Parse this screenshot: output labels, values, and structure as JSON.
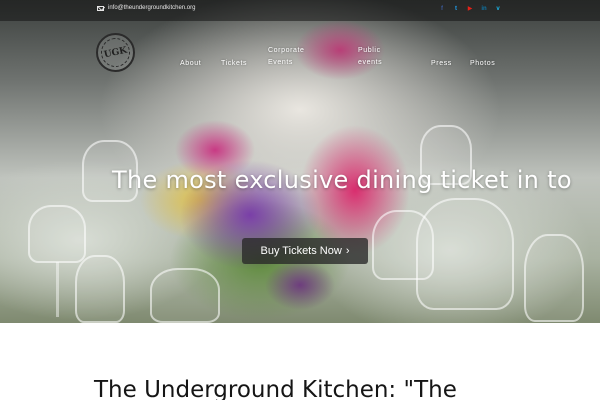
{
  "topbar": {
    "email": "info@theundergroundkitchen.org",
    "social_icons": [
      {
        "icon": "facebook-icon",
        "glyph": "f",
        "color": "#3b5998"
      },
      {
        "icon": "twitter-icon",
        "glyph": "t",
        "color": "#1da1f2"
      },
      {
        "icon": "youtube-icon",
        "glyph": "▶",
        "color": "#e62117"
      },
      {
        "icon": "linkedin-icon",
        "glyph": "in",
        "color": "#0e76a8"
      },
      {
        "icon": "vimeo-icon",
        "glyph": "v",
        "color": "#1ab7ea"
      }
    ]
  },
  "logo": {
    "text": "UGK"
  },
  "nav": {
    "items": [
      {
        "label": "About"
      },
      {
        "label": "Tickets"
      },
      {
        "label": "Corporate\nEvents"
      },
      {
        "label": "Public\nevents"
      },
      {
        "label": "Press"
      },
      {
        "label": "Photos"
      }
    ]
  },
  "hero": {
    "headline": "The most exclusive dining ticket in to",
    "cta_label": "Buy Tickets Now",
    "cta_icon": "chevron-right-icon"
  },
  "section": {
    "title": "The Underground Kitchen: \"The"
  }
}
